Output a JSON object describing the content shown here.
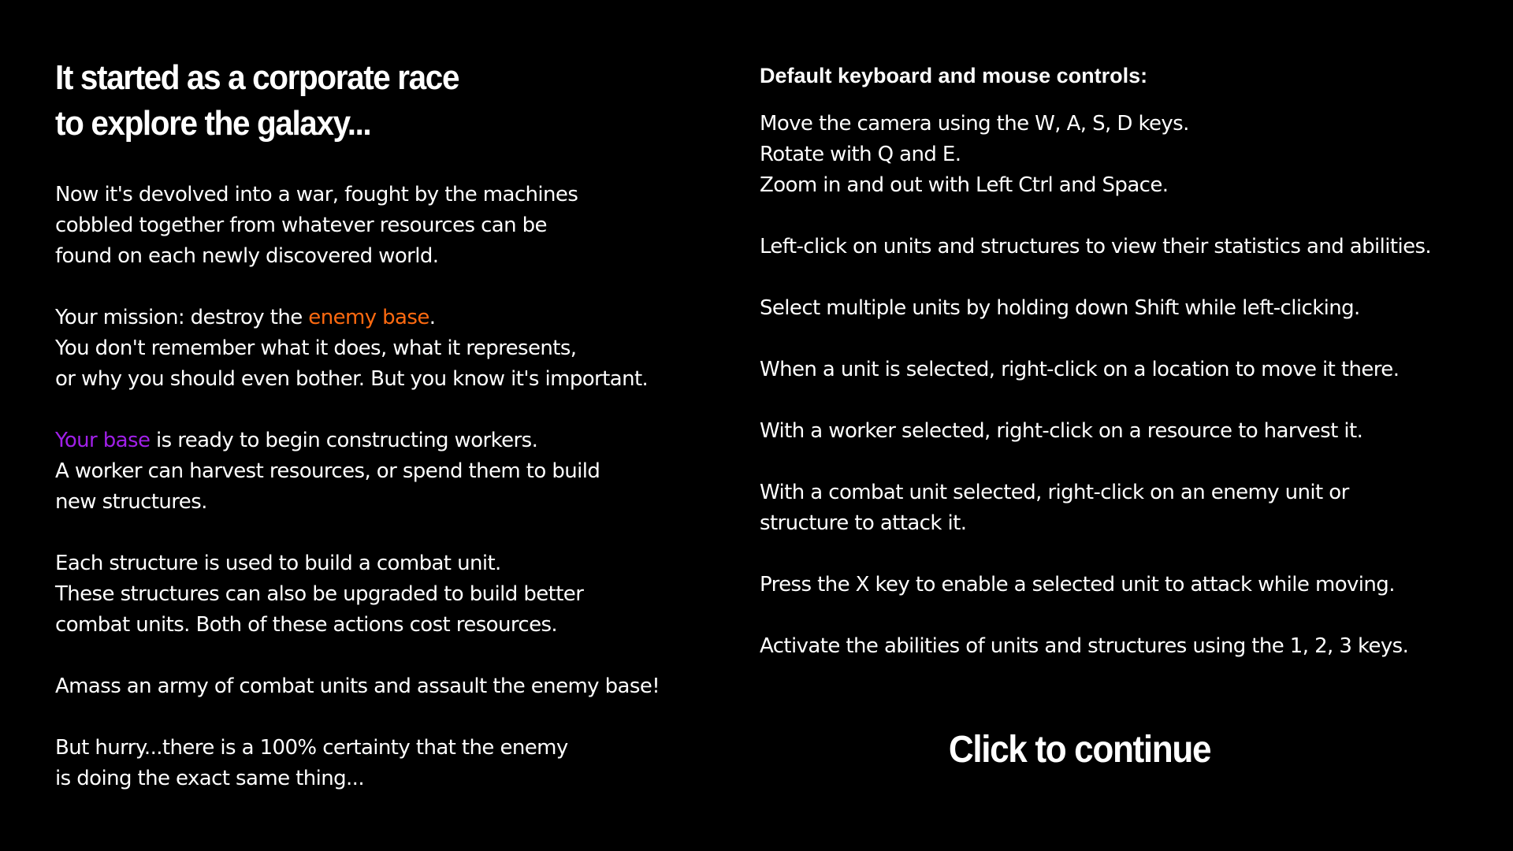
{
  "intro": {
    "heading": [
      "It started as a corporate race",
      "to explore the galaxy..."
    ],
    "paragraph1": [
      "Now it's devolved into a war, fought by the machines",
      "cobbled together from whatever resources can be",
      "found on each newly discovered world."
    ],
    "mission": {
      "prefix": "Your mission: destroy the ",
      "highlight": "enemy base",
      "suffix": ".",
      "line2": "You don't remember what it does, what it represents,",
      "line3": "or why you should even bother.  But you know it's important."
    },
    "base": {
      "highlight": "Your base",
      "suffix": " is ready to begin constructing workers.",
      "line2": "A worker can harvest resources, or spend them to build",
      "line3": "new structures."
    },
    "paragraph4": [
      "Each structure is used to build a combat unit.",
      "These structures can also be upgraded to build better",
      "combat units.  Both of these actions cost resources."
    ],
    "paragraph5": [
      "Amass an army of combat units and assault the enemy base!"
    ],
    "paragraph6": [
      "But hurry...there is a 100% certainty that the enemy",
      "is doing the exact same thing..."
    ]
  },
  "controls": {
    "title": "Default keyboard and mouse controls:",
    "camera": [
      "Move the camera using the W, A, S, D keys.",
      "Rotate with Q and E.",
      "Zoom in and out with Left Ctrl and Space."
    ],
    "select": [
      "Left-click on units and structures to view their statistics and abilities."
    ],
    "multi_select": [
      "Select multiple units by holding down Shift while left-clicking."
    ],
    "move": [
      "When a unit is selected, right-click on a location to move it there."
    ],
    "harvest": [
      "With a worker selected, right-click on a resource to harvest it."
    ],
    "attack": [
      "With a combat unit selected, right-click on an enemy unit or",
      "structure to attack it."
    ],
    "attack_move": [
      "Press the X key to enable a selected unit to attack while moving."
    ],
    "abilities": [
      "Activate the abilities of units and structures using the 1, 2, 3 keys."
    ]
  },
  "continue_label": "Click to continue",
  "colors": {
    "background": "#000000",
    "text": "#ffffff",
    "enemy_highlight": "#ff6a10",
    "player_highlight": "#a020e8"
  }
}
